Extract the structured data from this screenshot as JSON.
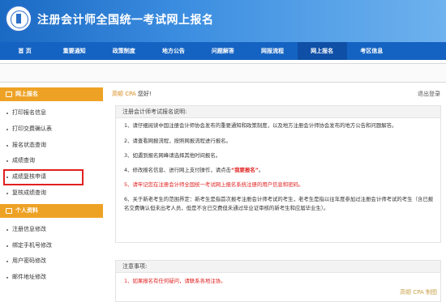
{
  "header": {
    "site_title": "注册会计师全国统一考试网上报名"
  },
  "nav": {
    "items": [
      "首 页",
      "重要通知",
      "政策制度",
      "地方公告",
      "问题解答",
      "网报流程",
      "网上报名",
      "考区信息"
    ],
    "active_index": 6
  },
  "sidebar": {
    "section1_title": "网上报名",
    "section1_items": [
      "打印报名信息",
      "打印交费确认表",
      "报名状态查询",
      "成绩查询",
      "成绩复核申请",
      "复核成绩查询"
    ],
    "highlighted_item": "成绩复核申请",
    "section2_title": "个人资料",
    "section2_items": [
      "注册信息修改",
      "绑定手机号修改",
      "用户密码修改",
      "邮件地址修改"
    ]
  },
  "main": {
    "greet_name": "高顿 CPA",
    "greet_suffix": " 您好!",
    "logout_label": "退出登录",
    "notice_title": "注册会计师考试报名说明:",
    "p1": "1、请仔细阅读中国注册会计师协会发布的重要通知和政策制度，以及地方注册会计师协会发布的地方公告和问题解答。",
    "p2": "2、请查看网报流程，按照网报流程进行报名。",
    "p3": "3、如遇到报名网峰请选择其他时间报名。",
    "p4_prefix": "4、修改报名信息、进行网上支付操作，请点击",
    "p4_link": "“我要报名”",
    "p4_suffix": "。",
    "p5": "5、请牢记您在注册会计师全国统一考试网上报名系统注册的用户信息和密码。",
    "p6": "6、关于新老考生的范围界定：新考生是指首次报考注册会计师考试的考生，老考生是指以往年度参加过注册会计师考试的考生（含已报名交费确认但未出考人员，但是不含已交费但未通过毕业证审核的新考生和应届毕业生）。",
    "note_title": "注意事项:",
    "note_line": "1、如果报名有任何疑问，请联系各地注协。",
    "watermark": "高顿 CPA  制图"
  }
}
